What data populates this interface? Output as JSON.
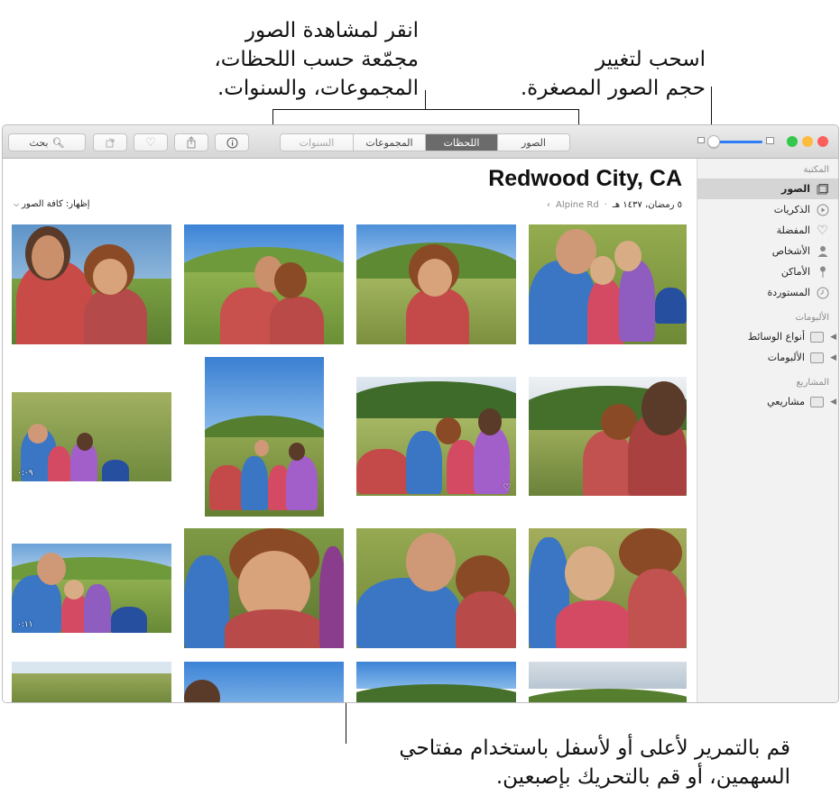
{
  "callouts": {
    "thumbnail_size": [
      "اسحب لتغيير",
      "حجم الصور المصغرة."
    ],
    "tabs": [
      "انقر لمشاهدة الصور",
      "مجمّعة حسب اللحظات،",
      "المجموعات، والسنوات."
    ],
    "scroll": [
      "قم بالتمرير لأعلى أو لأسفل باستخدام مفتاحي",
      "السهمين، أو قم بالتحريك بإصبعين."
    ]
  },
  "toolbar": {
    "search_label": "بحث",
    "tabs": [
      {
        "label": "السنوات",
        "active": false
      },
      {
        "label": "المجموعات",
        "active": false
      },
      {
        "label": "اللحظات",
        "active": true
      },
      {
        "label": "الصور",
        "active": false
      }
    ],
    "thumbnail_slider_value": 0.0,
    "traffic_lights": {
      "close": "#fc605c",
      "minimize": "#fdbc40",
      "zoom": "#34c84a"
    },
    "accent": "#2f7df6"
  },
  "sidebar": {
    "library_header": "المكتبة",
    "library_items": [
      {
        "label": "الصور",
        "icon": "photos-icon",
        "selected": true
      },
      {
        "label": "الذكريات",
        "icon": "memories-icon",
        "selected": false
      },
      {
        "label": "المفضلة",
        "icon": "heart-icon",
        "selected": false
      },
      {
        "label": "الأشخاص",
        "icon": "person-icon",
        "selected": false
      },
      {
        "label": "الأماكن",
        "icon": "pin-icon",
        "selected": false
      },
      {
        "label": "المستوردة",
        "icon": "clock-icon",
        "selected": false
      }
    ],
    "albums_header": "الألبومات",
    "album_items": [
      {
        "label": "أنواع الوسائط",
        "icon": "folder-icon"
      },
      {
        "label": "الألبومات",
        "icon": "folder-icon"
      }
    ],
    "projects_header": "المشاريع",
    "project_items": [
      {
        "label": "مشاريعي",
        "icon": "folder-icon"
      }
    ]
  },
  "main": {
    "place_title": "Redwood City, CA",
    "date": "٥ رمضان، ١٤٣٧ هـ",
    "separator": "·",
    "sub_location": "Alpine Rd",
    "show_filter": "إظهار: كافة الصور",
    "video_durations": [
      "٠:٠٩",
      "٠:١١"
    ]
  }
}
